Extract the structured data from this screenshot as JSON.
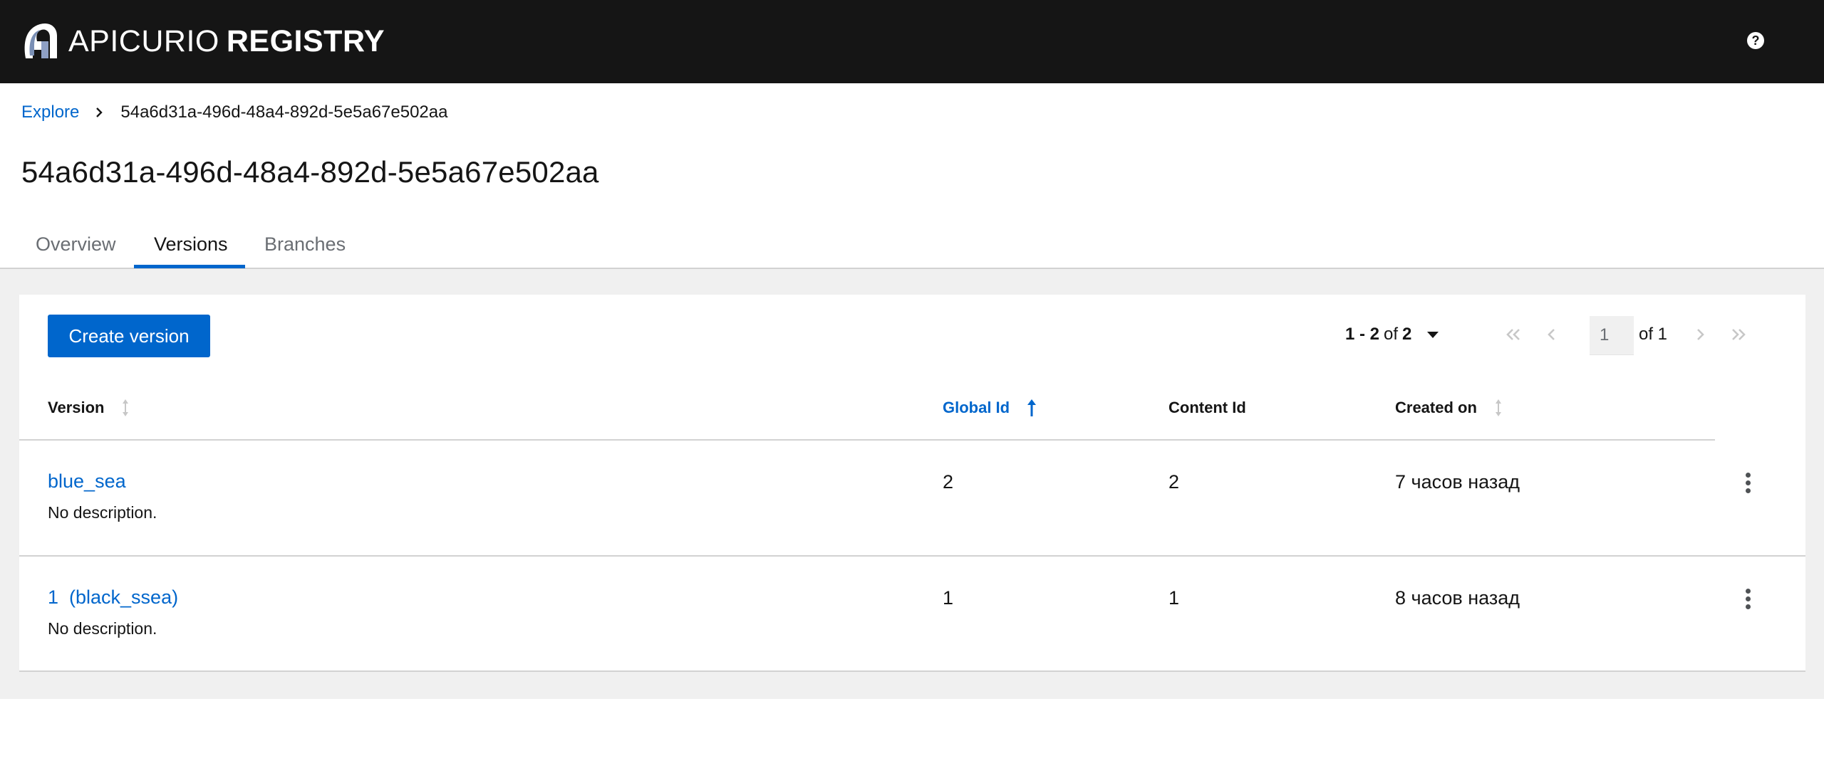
{
  "header": {
    "brand_light": "APICURIO",
    "brand_bold": "REGISTRY",
    "help_icon_label": "?"
  },
  "breadcrumb": {
    "explore": "Explore",
    "current": "54a6d31a-496d-48a4-892d-5e5a67e502aa"
  },
  "page": {
    "title": "54a6d31a-496d-48a4-892d-5e5a67e502aa"
  },
  "tabs": [
    {
      "label": "Overview",
      "active": false
    },
    {
      "label": "Versions",
      "active": true
    },
    {
      "label": "Branches",
      "active": false
    }
  ],
  "toolbar": {
    "create_label": "Create version"
  },
  "pagination": {
    "range": "1 - 2",
    "of_label": "of",
    "total": "2",
    "page_value": "1",
    "page_of": "of 1"
  },
  "table": {
    "columns": [
      {
        "label": "Version",
        "sort": "none"
      },
      {
        "label": "Global Id",
        "sort": "asc"
      },
      {
        "label": "Content Id",
        "sort": "none"
      },
      {
        "label": "Created on",
        "sort": "none"
      }
    ],
    "rows": [
      {
        "version": "blue_sea",
        "description": "No description.",
        "global_id": "2",
        "content_id": "2",
        "created_on": "7 часов назад"
      },
      {
        "version": "1  (black_ssea)",
        "description": "No description.",
        "global_id": "1",
        "content_id": "1",
        "created_on": "8 часов назад"
      }
    ]
  },
  "colors": {
    "accent": "#0066cc",
    "masthead": "#151515",
    "background_gray": "#f0f0f0"
  }
}
